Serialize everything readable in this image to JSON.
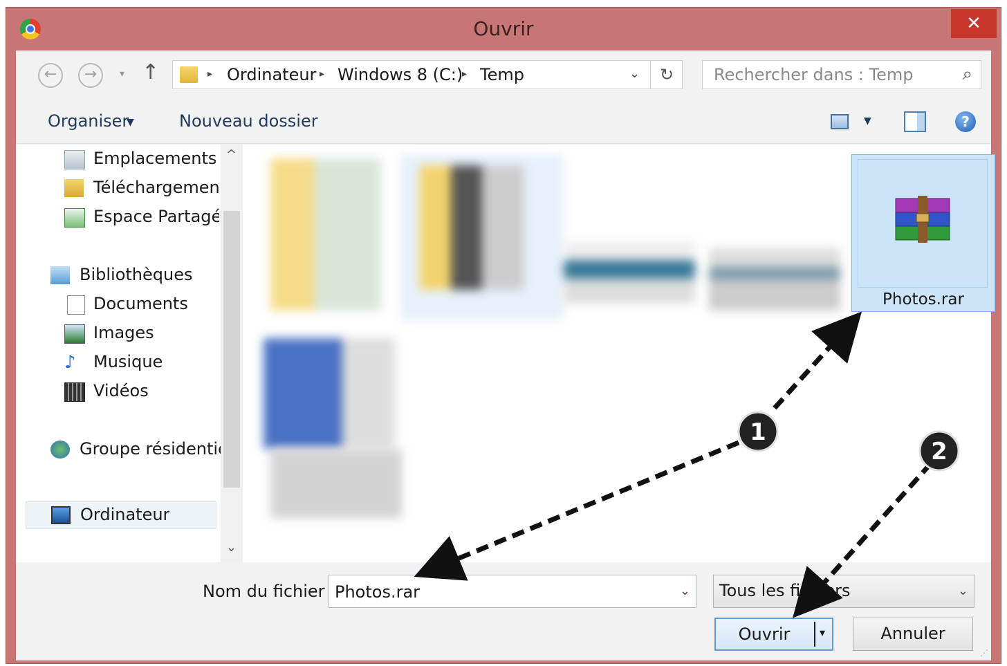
{
  "window": {
    "title": "Ouvrir",
    "close_glyph": "✕"
  },
  "navigation": {
    "back_glyph": "←",
    "forward_glyph": "→",
    "recent_glyph": "▾",
    "up_glyph": "↑",
    "breadcrumb": [
      "Ordinateur",
      "Windows 8 (C:)",
      "Temp"
    ],
    "separator_glyph": "▸",
    "dropdown_glyph": "⌄",
    "refresh_glyph": "↻"
  },
  "search": {
    "placeholder": "Rechercher dans : Temp",
    "icon": "⌕"
  },
  "toolbar": {
    "organize": "Organiser",
    "organize_caret": "▼",
    "new_folder": "Nouveau dossier",
    "view_caret": "▼",
    "help_glyph": "?"
  },
  "sidebar": {
    "favorites": [
      "Emplacements récents",
      "Téléchargements",
      "Espace Partagé"
    ],
    "libraries_header": "Bibliothèques",
    "libraries": [
      "Documents",
      "Images",
      "Musique",
      "Vidéos"
    ],
    "homegroup": "Groupe résidentiel",
    "computer": "Ordinateur",
    "scroll_up": "^",
    "scroll_down": "⌄"
  },
  "files": {
    "selected_name": "Photos.rar"
  },
  "filename": {
    "label": "Nom du fichier :",
    "value": "Photos.rar",
    "dropdown_glyph": "⌄"
  },
  "filetype": {
    "value": "Tous les fichiers",
    "dropdown_glyph": "⌄"
  },
  "buttons": {
    "open": "Ouvrir",
    "open_split": "▾",
    "cancel": "Annuler"
  },
  "annotations": [
    "1",
    "2"
  ],
  "colors": {
    "title_bar": "#c87575",
    "close_button": "#c7362b",
    "selection": "#cce4f7"
  }
}
